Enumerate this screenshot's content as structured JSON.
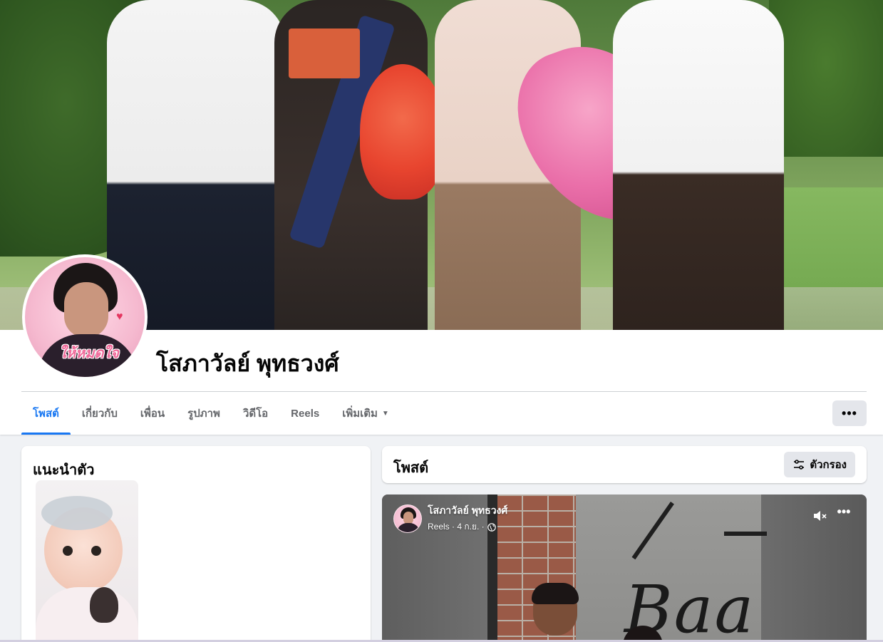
{
  "profile": {
    "name": "โสภาวัลย์ พุทธวงศ์",
    "avatar_caption": "ให้หมดใจ"
  },
  "nav": {
    "tabs": [
      {
        "label": "โพสต์",
        "active": true
      },
      {
        "label": "เกี่ยวกับ",
        "active": false
      },
      {
        "label": "เพื่อน",
        "active": false
      },
      {
        "label": "รูปภาพ",
        "active": false
      },
      {
        "label": "วิดีโอ",
        "active": false
      },
      {
        "label": "Reels",
        "active": false
      },
      {
        "label": "เพิ่มเติม",
        "active": false
      }
    ],
    "more_icon": "ellipsis-icon"
  },
  "intro": {
    "title": "แนะนำตัว"
  },
  "posts": {
    "title": "โพสต์",
    "filter_label": "ตัวกรอง"
  },
  "reel": {
    "author": "โสภาวัลย์ พุทธวงศ์",
    "sub": "Reels · 4 ก.ย. ·",
    "sign_text": "Baa"
  },
  "colors": {
    "accent": "#1877f2",
    "page_bg": "#f0f2f5",
    "button_bg": "#e4e6eb"
  }
}
